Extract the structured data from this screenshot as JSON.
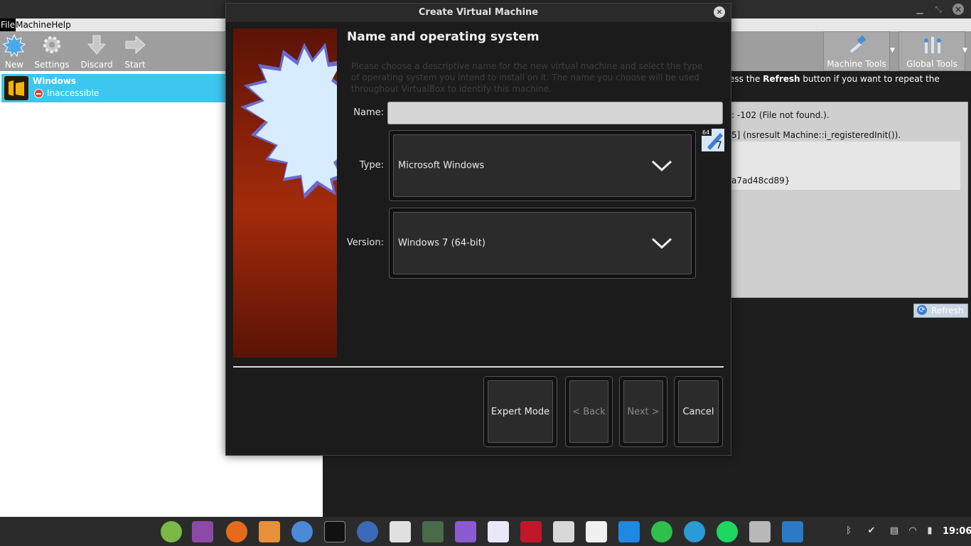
{
  "main_window": {
    "menu": [
      "File",
      "Machine",
      "Help"
    ],
    "toolbar": {
      "new_label": "New",
      "settings_label": "Settings",
      "discard_label": "Discard",
      "start_label": "Start"
    },
    "tool_tabs": {
      "machine_tools_label": "Machine Tools",
      "global_tools_label": "Global Tools"
    },
    "vm": {
      "name": "Windows",
      "state": "Inaccessible"
    },
    "details": {
      "top_prefix": "ess the ",
      "top_bold": "Refresh",
      "top_suffix": " button if you want to repeat the",
      "line1": ": -102 (File not found.).",
      "line2": "5] (nsresult Machine::i_registeredInit()).",
      "line3": "a7ad48cd89}",
      "refresh_label": "Refresh"
    }
  },
  "dialog": {
    "title": "Create Virtual Machine",
    "heading": "Name and operating system",
    "description": "Please choose a descriptive name for the new virtual machine and select the type of operating system you intend to install on it. The name you choose will be used throughout VirtualBox to identify this machine.",
    "name_label": "Name:",
    "name_value": "",
    "type_label": "Type:",
    "type_value": "Microsoft Windows",
    "version_label": "Version:",
    "version_value": "Windows 7 (64-bit)",
    "os_icon_badge_top": "64",
    "os_icon_badge_num": "7",
    "buttons": {
      "expert_mode": "Expert Mode",
      "back": "< Back",
      "next": "Next >",
      "cancel": "Cancel"
    }
  },
  "taskbar": {
    "clock": "19:06",
    "apps": [
      "mint-menu",
      "files-manager",
      "firefox",
      "folder",
      "chromium",
      "terminal",
      "thunderbird",
      "text-editor",
      "system-monitor",
      "obsidian",
      "libreoffice-writer",
      "mendeley",
      "texmaker",
      "xournal",
      "vscode",
      "whatsapp",
      "telegram",
      "spotify",
      "virtualbox-tools",
      "resource-monitor"
    ],
    "tray": [
      "bluetooth-icon",
      "shield-icon",
      "printer-icon",
      "wifi-icon",
      "battery-icon"
    ]
  },
  "colors": {
    "selection": "#3dc6f0",
    "toolbar": "#9e9e9e",
    "dialog_bg": "#1b1b1b",
    "watermark_red": "#8a2208"
  }
}
